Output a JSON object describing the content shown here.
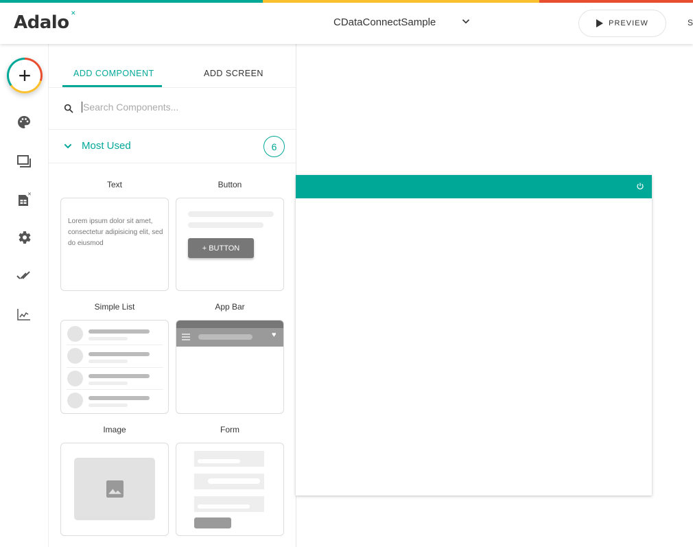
{
  "colors": {
    "teal": "#00a898",
    "yellow": "#fbc02d",
    "red": "#e94e2f"
  },
  "header": {
    "logo": "Adalo",
    "app_name": "CDataConnectSample",
    "preview_label": "PREVIEW",
    "share_partial": "S"
  },
  "rail": {
    "icons": [
      "add-icon",
      "palette-icon",
      "screens-icon",
      "database-icon",
      "settings-icon",
      "publish-icon",
      "analytics-icon"
    ]
  },
  "panel": {
    "tabs": [
      {
        "label": "ADD COMPONENT",
        "active": true
      },
      {
        "label": "ADD SCREEN",
        "active": false
      }
    ],
    "search": {
      "placeholder": "Search Components...",
      "value": ""
    },
    "section": {
      "label": "Most Used",
      "count": "6"
    },
    "components": [
      {
        "label": "Text",
        "preview_text": "Lorem ipsum dolor sit amet, consectetur adipisicing elit, sed do eiusmod"
      },
      {
        "label": "Button",
        "preview_text": "+ BUTTON"
      },
      {
        "label": "Simple List"
      },
      {
        "label": "App Bar"
      },
      {
        "label": "Image"
      },
      {
        "label": "Form"
      }
    ]
  }
}
